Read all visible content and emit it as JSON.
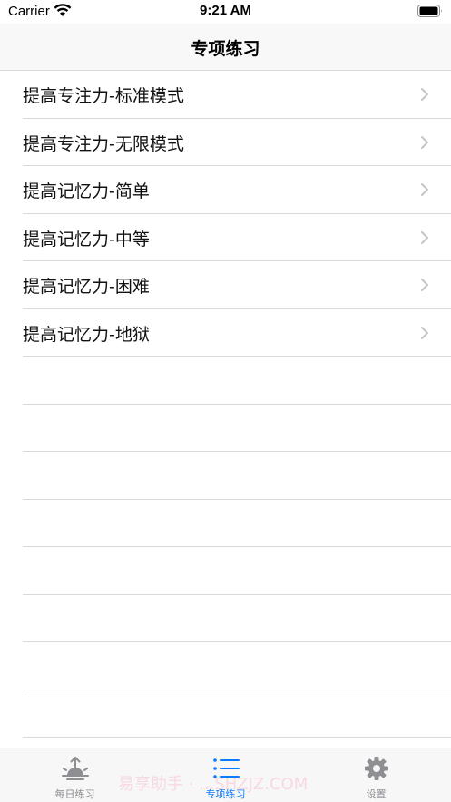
{
  "status_bar": {
    "carrier": "Carrier",
    "time": "9:21 AM"
  },
  "nav": {
    "title": "专项练习"
  },
  "list": {
    "items": [
      {
        "label": "提高专注力-标准模式"
      },
      {
        "label": "提高专注力-无限模式"
      },
      {
        "label": "提高记忆力-简单"
      },
      {
        "label": "提高记忆力-中等"
      },
      {
        "label": "提高记忆力-困难"
      },
      {
        "label": "提高记忆力-地狱"
      }
    ]
  },
  "tab_bar": {
    "tabs": [
      {
        "label": "每日练习",
        "icon": "sunrise-icon",
        "active": false
      },
      {
        "label": "专项练习",
        "icon": "list-icon",
        "active": true
      },
      {
        "label": "设置",
        "icon": "gear-icon",
        "active": false
      }
    ]
  },
  "watermark": "易享助手 · ...SHZJZ.COM",
  "colors": {
    "accent": "#0a7aff",
    "inactive": "#8e8e93",
    "nav_bg": "#f8f8f8",
    "separator": "#d9d9dc"
  }
}
